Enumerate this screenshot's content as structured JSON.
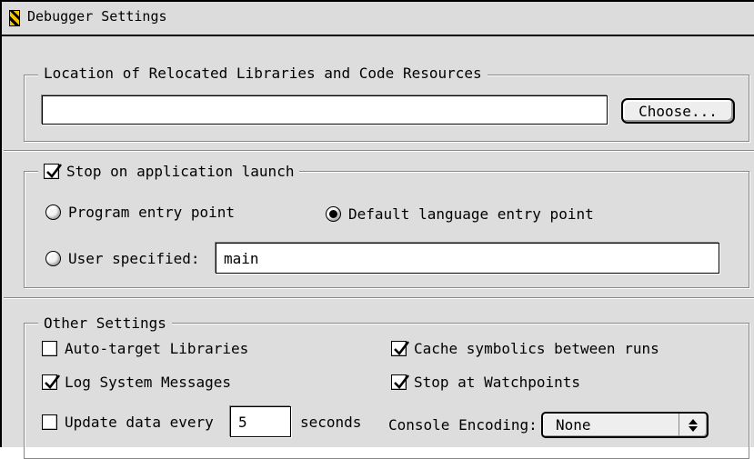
{
  "window": {
    "title": "Debugger Settings"
  },
  "libraries": {
    "legend": "Location of Relocated Libraries and Code Resources",
    "path_value": "",
    "choose_label": "Choose..."
  },
  "launch": {
    "stop_on_launch_label": "Stop on application launch",
    "stop_on_launch_checked": true,
    "program_entry_label": "Program entry point",
    "default_entry_label": "Default language entry point",
    "user_specified_label": "User specified:",
    "user_specified_value": "main",
    "selected": "default"
  },
  "other": {
    "legend": "Other Settings",
    "auto_target_label": "Auto-target Libraries",
    "auto_target_checked": false,
    "cache_symbolics_label": "Cache symbolics between runs",
    "cache_symbolics_checked": true,
    "log_system_label": "Log System Messages",
    "log_system_checked": true,
    "stop_watchpoints_label": "Stop at Watchpoints",
    "stop_watchpoints_checked": true,
    "update_every_label": "Update data every",
    "update_every_checked": false,
    "update_every_value": "5",
    "seconds_label": "seconds",
    "console_encoding_label": "Console Encoding:",
    "console_encoding_value": "None"
  }
}
